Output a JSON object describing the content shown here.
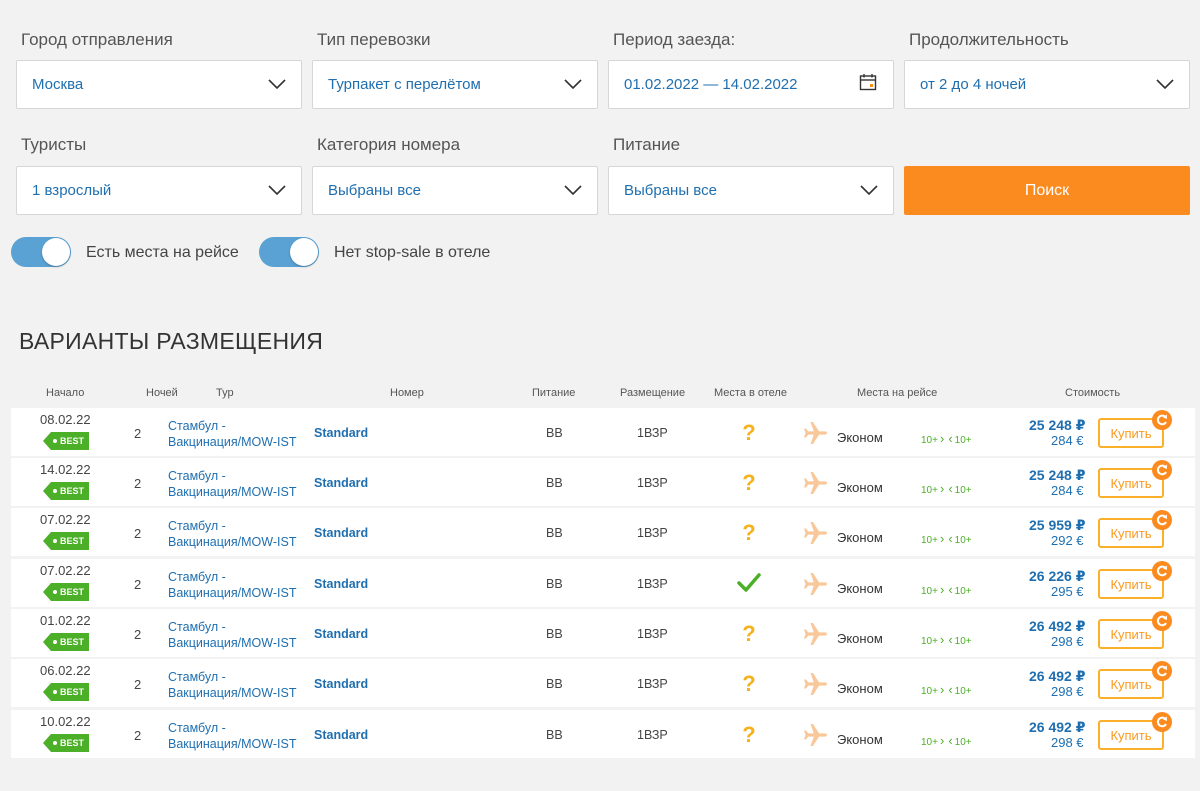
{
  "filters": {
    "departure": {
      "label": "Город отправления",
      "value": "Москва"
    },
    "transport": {
      "label": "Тип перевозки",
      "value": "Турпакет с перелётом"
    },
    "period": {
      "label": "Период заезда:",
      "value": "01.02.2022 — 14.02.2022"
    },
    "duration": {
      "label": "Продолжительность",
      "value": "от 2 до 4 ночей"
    },
    "tourists": {
      "label": "Туристы",
      "value": "1 взрослый"
    },
    "room_category": {
      "label": "Категория номера",
      "value": "Выбраны все"
    },
    "meal": {
      "label": "Питание",
      "value": "Выбраны все"
    },
    "search_label": "Поиск"
  },
  "toggles": {
    "flight_seats": {
      "label": "Есть места на рейсе",
      "on": true
    },
    "no_stop_sale": {
      "label": "Нет stop-sale в отеле",
      "on": true
    }
  },
  "results": {
    "title": "ВАРИАНТЫ РАЗМЕЩЕНИЯ",
    "headers": {
      "start": "Начало",
      "nights": "Ночей",
      "tour": "Тур",
      "room": "Номер",
      "meal": "Питание",
      "placement": "Размещение",
      "hotel_seats": "Места в отеле",
      "flight_seats": "Места на рейсе",
      "price": "Стоимость"
    },
    "best_label": "BEST",
    "buy_label": "Купить",
    "class_label": "Эконом",
    "seats_out": "10+",
    "seats_back": "10+",
    "rows": [
      {
        "date": "08.02.22",
        "nights": "2",
        "tour_line1": "Стамбул -",
        "tour_line2": "Вакцинация/MOW-IST",
        "room": "Standard",
        "meal": "BB",
        "placement": "1ВЗР",
        "hotel_status": "question",
        "rub": "25 248 ₽",
        "eur": "284 €"
      },
      {
        "date": "14.02.22",
        "nights": "2",
        "tour_line1": "Стамбул -",
        "tour_line2": "Вакцинация/MOW-IST",
        "room": "Standard",
        "meal": "BB",
        "placement": "1ВЗР",
        "hotel_status": "question",
        "rub": "25 248 ₽",
        "eur": "284 €"
      },
      {
        "date": "07.02.22",
        "nights": "2",
        "tour_line1": "Стамбул -",
        "tour_line2": "Вакцинация/MOW-IST",
        "room": "Standard",
        "meal": "BB",
        "placement": "1ВЗР",
        "hotel_status": "question",
        "rub": "25 959 ₽",
        "eur": "292 €"
      },
      {
        "date": "07.02.22",
        "nights": "2",
        "tour_line1": "Стамбул -",
        "tour_line2": "Вакцинация/MOW-IST",
        "room": "Standard",
        "meal": "BB",
        "placement": "1ВЗР",
        "hotel_status": "check",
        "rub": "26 226 ₽",
        "eur": "295 €"
      },
      {
        "date": "01.02.22",
        "nights": "2",
        "tour_line1": "Стамбул -",
        "tour_line2": "Вакцинация/MOW-IST",
        "room": "Standard",
        "meal": "BB",
        "placement": "1ВЗР",
        "hotel_status": "question",
        "rub": "26 492 ₽",
        "eur": "298 €"
      },
      {
        "date": "06.02.22",
        "nights": "2",
        "tour_line1": "Стамбул -",
        "tour_line2": "Вакцинация/MOW-IST",
        "room": "Standard",
        "meal": "BB",
        "placement": "1ВЗР",
        "hotel_status": "question",
        "rub": "26 492 ₽",
        "eur": "298 €"
      },
      {
        "date": "10.02.22",
        "nights": "2",
        "tour_line1": "Стамбул -",
        "tour_line2": "Вакцинация/MOW-IST",
        "room": "Standard",
        "meal": "BB",
        "placement": "1ВЗР",
        "hotel_status": "question",
        "rub": "26 492 ₽",
        "eur": "298 €"
      }
    ]
  },
  "colors": {
    "accent_orange": "#fb8a1f",
    "link_blue": "#1f6fb0",
    "best_green": "#4caf28",
    "toggle_blue": "#5aa2d4"
  }
}
